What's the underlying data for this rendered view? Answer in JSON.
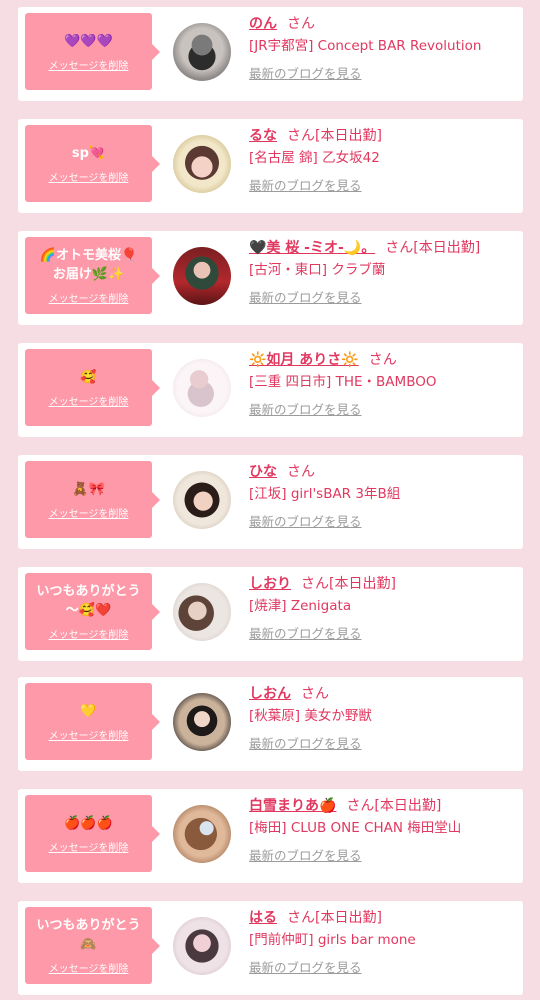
{
  "delete_label": "メッセージを削除",
  "blog_label": "最新のブログを見る",
  "accent_color": "#e13860",
  "bubble_color": "#fd99a8",
  "cards": [
    {
      "message": "💜💜💜",
      "name": "のん",
      "suffix": "さん",
      "shop": "[JR宇都宮] Concept BAR Revolution"
    },
    {
      "message": "sp💘",
      "name": "るな",
      "suffix": "さん[本日出勤]",
      "shop": "[名古屋 錦] 乙女坂42"
    },
    {
      "message": "🌈オトモ美桜🎈\nお届け🌿✨",
      "name": "🖤美 桜 -ミオ-🌙。",
      "suffix": "さん[本日出勤]",
      "shop": "[古河・東口] クラブ蘭"
    },
    {
      "message": "🥰",
      "name": "🔆如月 ありさ🔆",
      "suffix": "さん",
      "shop": "[三重 四日市] THE・BAMBOO"
    },
    {
      "message": "🧸🎀",
      "name": "ひな",
      "suffix": "さん",
      "shop": "[江坂] girl'sBAR 3年B組"
    },
    {
      "message": "いつもありがとう\n〜🥰❤️",
      "name": "しおり",
      "suffix": "さん[本日出勤]",
      "shop": "[焼津] Zenigata"
    },
    {
      "message": "💛",
      "name": "しおん",
      "suffix": "さん",
      "shop": "[秋葉原] 美女か野獣"
    },
    {
      "message": "🍎🍎🍎",
      "name": "白雪まりあ🍎",
      "suffix": "さん[本日出勤]",
      "shop": "[梅田] CLUB ONE CHAN 梅田堂山"
    },
    {
      "message": "いつもありがとう\n🙈",
      "name": "はる",
      "suffix": "さん[本日出勤]",
      "shop": "[門前仲町] girls bar mone"
    }
  ]
}
